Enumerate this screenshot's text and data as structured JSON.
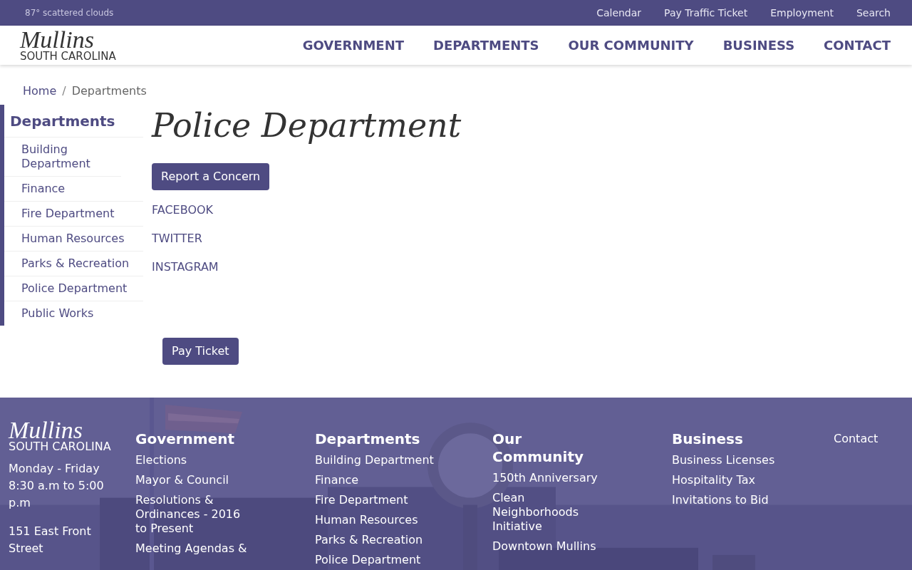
{
  "top_bar": {
    "weather": "87° scattered clouds",
    "links": [
      "Calendar",
      "Pay Traffic Ticket",
      "Employment",
      "Search"
    ]
  },
  "header": {
    "logo": {
      "name": "Mullins",
      "state": "SOUTH CAROLINA"
    },
    "nav": [
      "GOVERNMENT",
      "DEPARTMENTS",
      "OUR COMMUNITY",
      "BUSINESS",
      "CONTACT"
    ]
  },
  "breadcrumb": {
    "separator": "/",
    "items": [
      "Home",
      "Departments"
    ]
  },
  "sidebar": {
    "title": "Departments",
    "items": [
      "Building Department",
      "Finance",
      "Fire Department",
      "Human Resources",
      "Parks & Recreation",
      "Police Department",
      "Public Works"
    ]
  },
  "main": {
    "title": "Police Department",
    "report_button": "Report a Concern",
    "social_links": [
      "FACEBOOK",
      "TWITTER",
      "INSTAGRAM"
    ],
    "pay_button": "Pay Ticket"
  },
  "footer": {
    "logo": {
      "name": "Mullins",
      "state": "SOUTH CAROLINA"
    },
    "hours": "Monday - Friday 8:30 a.m to 5:00 p.m",
    "address": "151 East Front Street",
    "columns": [
      {
        "title": "Government",
        "links": [
          "Elections",
          "Mayor & Council",
          "Resolutions & Ordinances - 2016 to Present",
          "Meeting Agendas &"
        ]
      },
      {
        "title": "Departments",
        "links": [
          "Building Department",
          "Finance",
          "Fire Department",
          "Human Resources",
          "Parks & Recreation",
          "Police Department"
        ]
      },
      {
        "title": "Our Community",
        "links": [
          "150th Anniversary",
          "Clean Neighborhoods Initiative",
          "Downtown Mullins"
        ]
      },
      {
        "title": "Business",
        "links": [
          "Business Licenses",
          "Hospitality Tax",
          "Invitations to Bid"
        ]
      }
    ],
    "contact": "Contact"
  }
}
